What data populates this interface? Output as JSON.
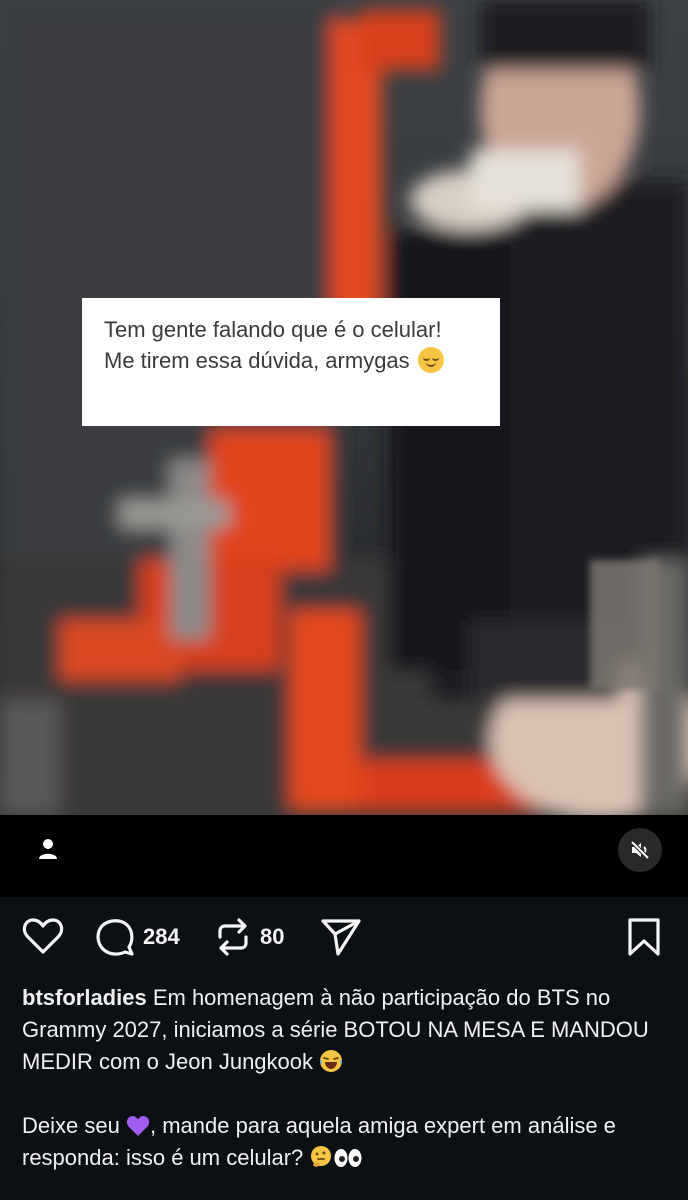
{
  "video": {
    "overlay_text": "Tem gente falando que é o celular! Me tirem essa dúvida, armygas",
    "overlay_emoji": "relieved-face-icon"
  },
  "video_bar": {
    "user_icon": "person-icon",
    "mute_icon": "speaker-muted-icon"
  },
  "actions": {
    "like_icon": "heart-icon",
    "comments_count": "284",
    "reposts_count": "80",
    "share_icon": "send-icon",
    "save_icon": "bookmark-icon"
  },
  "post": {
    "username": "btsforladies",
    "caption_1": "Em homenagem à não participação do BTS no Grammy 2027, iniciamos a série BOTOU NA MESA E MANDOU MEDIR com o Jeon Jungkook",
    "caption_2": "Deixe seu",
    "caption_3": ", mande para aquela amiga expert em análise e responda: isso é um celular?",
    "emojis": [
      "laughing-face-icon",
      "purple-heart-icon",
      "thinking-face-icon",
      "eyes-icon"
    ]
  },
  "colors": {
    "background": "#0c1014",
    "video_bar": "#000000",
    "overlay_box": "#ffffff",
    "scene_orange": "#e8431c"
  }
}
